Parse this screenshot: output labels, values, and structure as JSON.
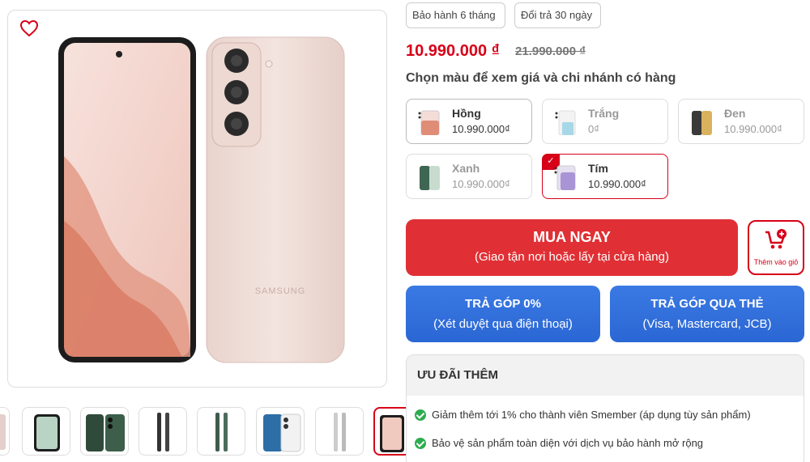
{
  "tags": [
    "Bảo hành 6 tháng",
    "Đổi trả 30 ngày"
  ],
  "price": {
    "current": "10.990.000 ₫",
    "old": "21.990.000 ₫"
  },
  "color_section": {
    "title": "Chọn màu để xem giá và chi nhánh có hàng"
  },
  "colors": [
    {
      "name": "Hồng",
      "price": "10.990.000₫",
      "swatch": "#e8a99a"
    },
    {
      "name": "Trắng",
      "price": "0₫",
      "swatch": "#f0f0f0"
    },
    {
      "name": "Đen",
      "price": "10.990.000₫",
      "swatch": "#3a3a3a"
    },
    {
      "name": "Xanh",
      "price": "10.990.000₫",
      "swatch": "#5f8f78"
    },
    {
      "name": "Tím",
      "price": "10.990.000₫",
      "swatch": "#b8a4d6"
    }
  ],
  "buy": {
    "label": "MUA NGAY",
    "sub": "(Giao tận nơi hoặc lấy tại cửa hàng)"
  },
  "cart": {
    "label": "Thêm vào giỏ"
  },
  "installment": [
    {
      "label": "TRẢ GÓP 0%",
      "sub": "(Xét duyệt qua điện thoại)"
    },
    {
      "label": "TRẢ GÓP QUA THẺ",
      "sub": "(Visa, Mastercard, JCB)"
    }
  ],
  "promo": {
    "title": "ƯU ĐÃI THÊM",
    "items": [
      "Giảm thêm tới 1% cho thành viên Smember (áp dụng tùy sản phẩm)",
      "Bảo vệ sản phẩm toàn diện với dịch vụ bảo hành mở rộng"
    ]
  },
  "product": {
    "brand_mark": "SAMSUNG"
  },
  "colors_theme": {
    "accent": "#d70018",
    "buy": "#e03035",
    "installment": "#2f6ed8",
    "check": "#2eac4f"
  }
}
